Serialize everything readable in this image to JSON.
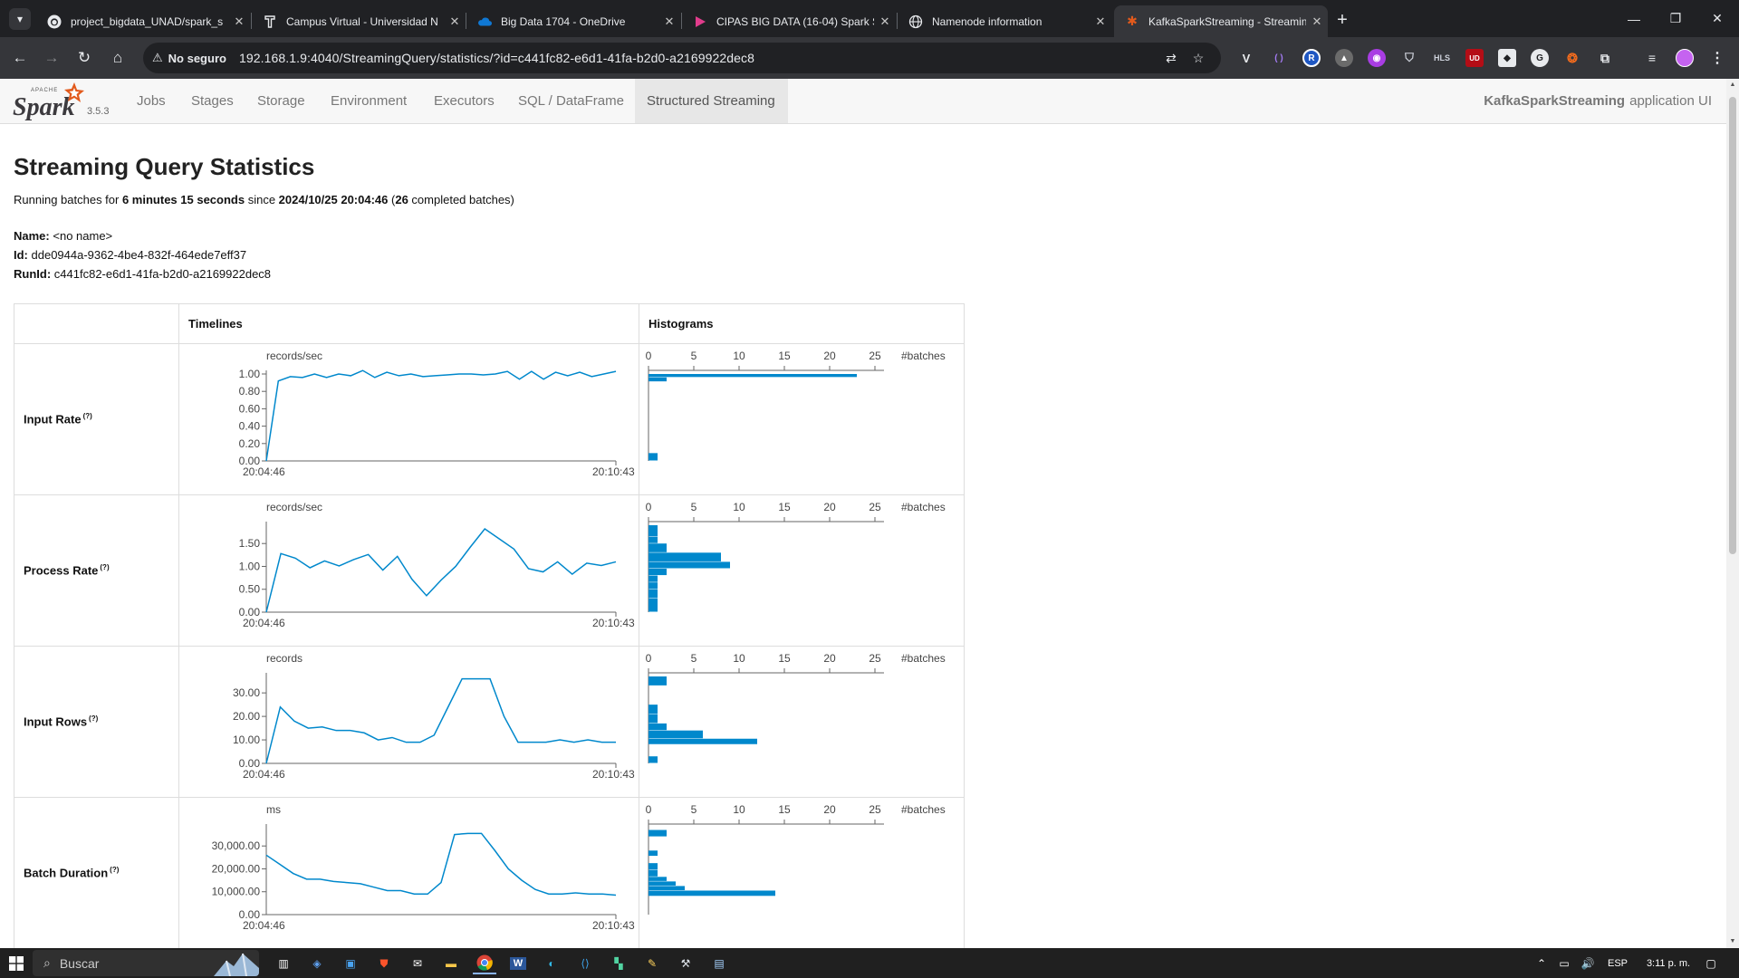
{
  "browser": {
    "tabs": [
      {
        "title": "project_bigdata_UNAD/spark_s",
        "icon": "github-icon"
      },
      {
        "title": "Campus Virtual - Universidad N",
        "icon": "campus-icon"
      },
      {
        "title": "Big Data 1704 - OneDrive",
        "icon": "onedrive-icon"
      },
      {
        "title": "CIPAS BIG DATA (16-04) Spark S",
        "icon": "clipchamp-icon"
      },
      {
        "title": "Namenode information",
        "icon": "globe-icon"
      },
      {
        "title": "KafkaSparkStreaming - Streamin",
        "icon": "spark-icon"
      }
    ],
    "security_label": "No seguro",
    "url": "192.168.1.9:4040/StreamingQuery/statistics/?id=c441fc82-e6d1-41fa-b2d0-a2169922dec8"
  },
  "spark": {
    "version": "3.5.3",
    "nav": [
      "Jobs",
      "Stages",
      "Storage",
      "Environment",
      "Executors",
      "SQL / DataFrame",
      "Structured Streaming"
    ],
    "active_nav": "Structured Streaming",
    "app_name": "KafkaSparkStreaming",
    "app_suffix": "application UI"
  },
  "page": {
    "title": "Streaming Query Statistics",
    "summary": {
      "prefix": "Running batches for ",
      "duration": "6 minutes 15 seconds",
      "since": " since ",
      "start": "2024/10/25 20:04:46",
      "open": " (",
      "batches": "26",
      "suffix": " completed batches)"
    },
    "meta": {
      "name_label": "Name:",
      "name_value": "<no name>",
      "id_label": "Id:",
      "id_value": "dde0944a-9362-4be4-832f-464ede7eff37",
      "runid_label": "RunId:",
      "runid_value": "c441fc82-e6d1-41fa-b2d0-a2169922dec8"
    },
    "table_headers": {
      "timelines": "Timelines",
      "histograms": "Histograms"
    },
    "help_marker": "(?)"
  },
  "chart_data": [
    {
      "type": "line",
      "title": "Input Rate",
      "unit": "records/sec",
      "x_start": "20:04:46",
      "x_end": "20:10:43",
      "yticks": [
        "0.00",
        "0.20",
        "0.40",
        "0.60",
        "0.80",
        "1.00"
      ],
      "ylim": [
        0,
        1.0
      ],
      "values": [
        0,
        0.92,
        0.97,
        0.96,
        1.0,
        0.96,
        1.0,
        0.98,
        1.04,
        0.96,
        1.02,
        0.98,
        1.0,
        0.97,
        0.98,
        0.99,
        1.0,
        1.0,
        0.99,
        1.0,
        1.03,
        0.94,
        1.03,
        0.94,
        1.02,
        0.98,
        1.02,
        0.97,
        1.0,
        1.03
      ],
      "histogram": {
        "xlabel": "#batches",
        "xticks": [
          0,
          5,
          10,
          15,
          20,
          25
        ],
        "xlim": [
          0,
          26
        ],
        "bins": [
          {
            "from": 0.0,
            "to": 0.09,
            "count": 1
          },
          {
            "from": 0.91,
            "to": 0.96,
            "count": 2
          },
          {
            "from": 0.96,
            "to": 1.04,
            "count": 23
          }
        ]
      }
    },
    {
      "type": "line",
      "title": "Process Rate",
      "unit": "records/sec",
      "x_start": "20:04:46",
      "x_end": "20:10:43",
      "yticks": [
        "0.00",
        "0.50",
        "1.00",
        "1.50"
      ],
      "ylim": [
        0,
        1.9
      ],
      "values": [
        0,
        1.28,
        1.18,
        0.97,
        1.12,
        1.01,
        1.15,
        1.26,
        0.92,
        1.22,
        0.72,
        0.36,
        0.7,
        1.0,
        1.42,
        1.82,
        1.6,
        1.38,
        0.95,
        0.88,
        1.1,
        0.83,
        1.07,
        1.02,
        1.1
      ],
      "histogram": {
        "xlabel": "#batches",
        "xticks": [
          0,
          5,
          10,
          15,
          20,
          25
        ],
        "xlim": [
          0,
          26
        ],
        "bins": [
          {
            "from": 0.0,
            "to": 0.3,
            "count": 1
          },
          {
            "from": 0.3,
            "to": 0.5,
            "count": 1
          },
          {
            "from": 0.5,
            "to": 0.65,
            "count": 1
          },
          {
            "from": 0.65,
            "to": 0.8,
            "count": 1
          },
          {
            "from": 0.8,
            "to": 0.95,
            "count": 2
          },
          {
            "from": 0.95,
            "to": 1.1,
            "count": 9
          },
          {
            "from": 1.1,
            "to": 1.3,
            "count": 8
          },
          {
            "from": 1.3,
            "to": 1.5,
            "count": 2
          },
          {
            "from": 1.5,
            "to": 1.65,
            "count": 1
          },
          {
            "from": 1.65,
            "to": 1.9,
            "count": 1
          }
        ]
      }
    },
    {
      "type": "line",
      "title": "Input Rows",
      "unit": "records",
      "x_start": "20:04:46",
      "x_end": "20:10:43",
      "yticks": [
        "0.00",
        "10.00",
        "20.00",
        "30.00"
      ],
      "ylim": [
        0,
        37
      ],
      "values": [
        0,
        24,
        18,
        15,
        15.5,
        14,
        14,
        13,
        10,
        11,
        9,
        9,
        12,
        24,
        36,
        36,
        36,
        20,
        9,
        9,
        9,
        10,
        9,
        10,
        9,
        9
      ],
      "histogram": {
        "xlabel": "#batches",
        "xticks": [
          0,
          5,
          10,
          15,
          20,
          25
        ],
        "xlim": [
          0,
          26
        ],
        "bins": [
          {
            "from": 0,
            "to": 3,
            "count": 1
          },
          {
            "from": 8,
            "to": 10.5,
            "count": 12
          },
          {
            "from": 10.5,
            "to": 14,
            "count": 6
          },
          {
            "from": 14,
            "to": 17,
            "count": 2
          },
          {
            "from": 17,
            "to": 21,
            "count": 1
          },
          {
            "from": 21,
            "to": 25,
            "count": 1
          },
          {
            "from": 33,
            "to": 37,
            "count": 2
          }
        ]
      }
    },
    {
      "type": "line",
      "title": "Batch Duration",
      "unit": "ms",
      "x_start": "20:04:46",
      "x_end": "20:10:43",
      "yticks": [
        "0.00",
        "10,000.00",
        "20,000.00",
        "30,000.00"
      ],
      "ylim": [
        0,
        38000
      ],
      "values": [
        26000,
        22000,
        18000,
        15500,
        15500,
        14500,
        14000,
        13500,
        12000,
        10500,
        10500,
        9000,
        9000,
        14000,
        35000,
        35500,
        35500,
        28000,
        20000,
        15000,
        11000,
        9000,
        9000,
        9500,
        9000,
        9000,
        8500
      ],
      "histogram": {
        "xlabel": "#batches",
        "xticks": [
          0,
          5,
          10,
          15,
          20,
          25
        ],
        "xlim": [
          0,
          26
        ],
        "bins": [
          {
            "from": 8000,
            "to": 10500,
            "count": 14
          },
          {
            "from": 10500,
            "to": 12500,
            "count": 4
          },
          {
            "from": 12500,
            "to": 14500,
            "count": 3
          },
          {
            "from": 14500,
            "to": 16500,
            "count": 2
          },
          {
            "from": 16500,
            "to": 19500,
            "count": 1
          },
          {
            "from": 19500,
            "to": 22500,
            "count": 1
          },
          {
            "from": 25500,
            "to": 28000,
            "count": 1
          },
          {
            "from": 34000,
            "to": 37000,
            "count": 2
          }
        ]
      }
    }
  ],
  "taskbar": {
    "search_placeholder": "Buscar",
    "language": "ESP",
    "time": "3:11 p. m."
  }
}
